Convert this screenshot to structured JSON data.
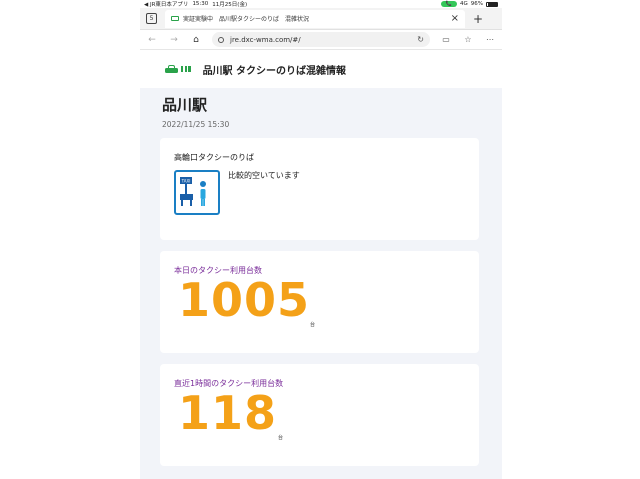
{
  "status_bar": {
    "carrier_app": "◀ JR東日本アプリ",
    "time": "15:30",
    "date": "11月25日(金)",
    "network": "4G",
    "battery": "96%",
    "call_indicator": "📞"
  },
  "tab_bar": {
    "tab_count": "5",
    "tab_title": "実証実験中　品川駅タクシーのりば　混雑状況",
    "close_icon": "×",
    "add_icon": "+"
  },
  "address_bar": {
    "url": "jre.dxc-wma.com/#/"
  },
  "page": {
    "site_title": "品川駅 タクシーのりば混雑情報",
    "station_name": "品川駅",
    "timestamp": "2022/11/25 15:30",
    "stand": {
      "title": "高輪口タクシーのりば",
      "icon_label": "TAXI",
      "status": "比較的空いています"
    },
    "today_usage": {
      "label": "本日のタクシー利用台数",
      "value": "1005",
      "unit": "台"
    },
    "hourly_usage": {
      "label": "直近1時間のタクシー利用台数",
      "value": "118",
      "unit": "台"
    }
  },
  "colors": {
    "brand_green": "#2aa24a",
    "number_orange": "#f4a118",
    "label_purple": "#7a2d9a",
    "icon_blue": "#1a7fc4",
    "page_bg": "#f2f4f9"
  }
}
